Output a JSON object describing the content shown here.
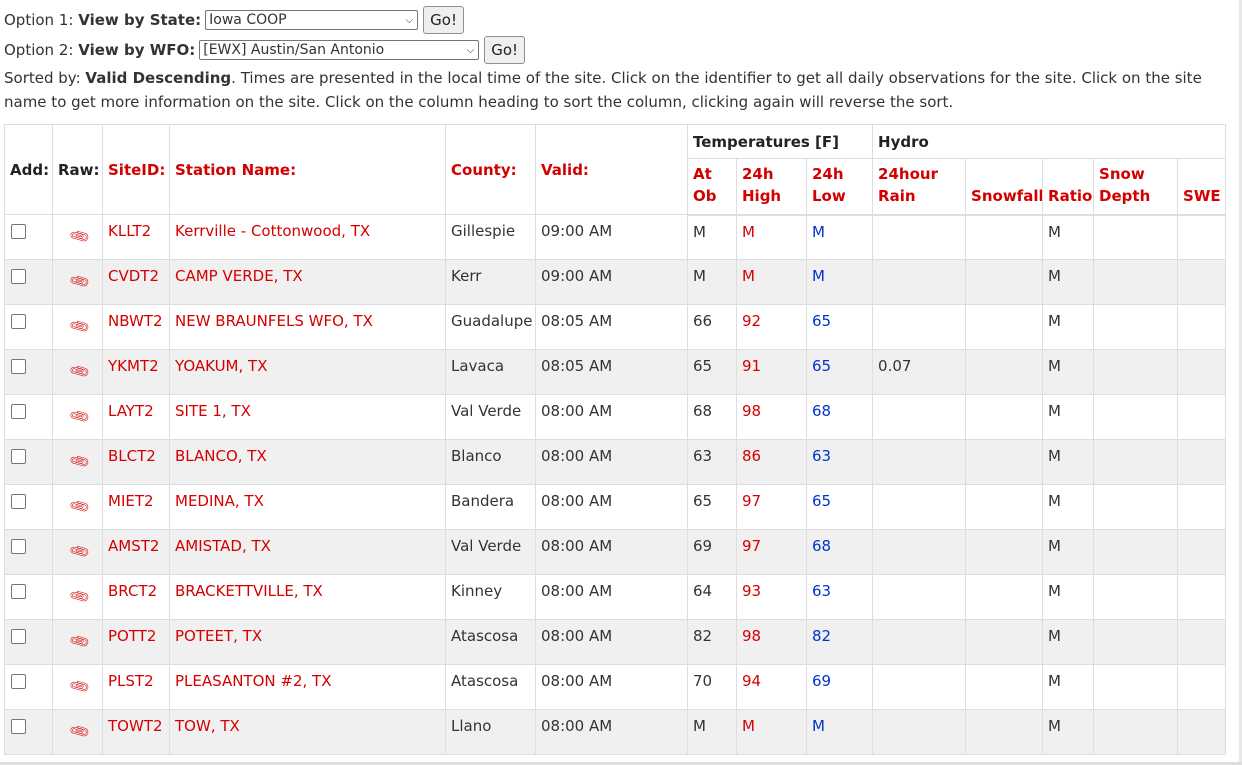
{
  "option1": {
    "prefix": "Option 1:",
    "label": "View by State:",
    "selected": "Iowa COOP",
    "go": "Go!"
  },
  "option2": {
    "prefix": "Option 2:",
    "label": "View by WFO:",
    "selected": "[EWX] Austin/San Antonio",
    "go": "Go!"
  },
  "info": {
    "sorted_prefix": "Sorted by:",
    "sorted_value": "Valid Descending",
    "text": ". Times are presented in the local time of the site. Click on the identifier to get all daily observations for the site. Click on the site name to get more information on the site. Click on the column heading to sort the column, clicking again will reverse the sort."
  },
  "table": {
    "group_temps": "Temperatures [F]",
    "group_hydro": "Hydro",
    "headers": {
      "add": "Add:",
      "raw": "Raw:",
      "siteid": "SiteID:",
      "name": "Station Name:",
      "county": "County:",
      "valid": "Valid:",
      "atob_1": "At",
      "atob_2": "Ob",
      "high_1": "24h",
      "high_2": "High",
      "low_1": "24h",
      "low_2": "Low",
      "rain_1": "24hour",
      "rain_2": "Rain",
      "snowfall": "Snowfall",
      "ratio": "Ratio",
      "depth_1": "Snow",
      "depth_2": "Depth",
      "swe": "SWE"
    },
    "rows": [
      {
        "id": "KLLT2",
        "name": "Kerrville - Cottonwood, TX",
        "county": "Gillespie",
        "valid": "09:00 AM",
        "atob": "M",
        "high": "M",
        "low": "M",
        "rain": "",
        "snowfall": "",
        "ratio": "M",
        "depth": "",
        "swe": ""
      },
      {
        "id": "CVDT2",
        "name": "CAMP VERDE, TX",
        "county": "Kerr",
        "valid": "09:00 AM",
        "atob": "M",
        "high": "M",
        "low": "M",
        "rain": "",
        "snowfall": "",
        "ratio": "M",
        "depth": "",
        "swe": ""
      },
      {
        "id": "NBWT2",
        "name": "NEW BRAUNFELS WFO, TX",
        "county": "Guadalupe",
        "valid": "08:05 AM",
        "atob": "66",
        "high": "92",
        "low": "65",
        "rain": "",
        "snowfall": "",
        "ratio": "M",
        "depth": "",
        "swe": ""
      },
      {
        "id": "YKMT2",
        "name": "YOAKUM, TX",
        "county": "Lavaca",
        "valid": "08:05 AM",
        "atob": "65",
        "high": "91",
        "low": "65",
        "rain": "0.07",
        "snowfall": "",
        "ratio": "M",
        "depth": "",
        "swe": ""
      },
      {
        "id": "LAYT2",
        "name": "SITE 1, TX",
        "county": "Val Verde",
        "valid": "08:00 AM",
        "atob": "68",
        "high": "98",
        "low": "68",
        "rain": "",
        "snowfall": "",
        "ratio": "M",
        "depth": "",
        "swe": ""
      },
      {
        "id": "BLCT2",
        "name": "BLANCO, TX",
        "county": "Blanco",
        "valid": "08:00 AM",
        "atob": "63",
        "high": "86",
        "low": "63",
        "rain": "",
        "snowfall": "",
        "ratio": "M",
        "depth": "",
        "swe": ""
      },
      {
        "id": "MIET2",
        "name": "MEDINA, TX",
        "county": "Bandera",
        "valid": "08:00 AM",
        "atob": "65",
        "high": "97",
        "low": "65",
        "rain": "",
        "snowfall": "",
        "ratio": "M",
        "depth": "",
        "swe": ""
      },
      {
        "id": "AMST2",
        "name": "AMISTAD, TX",
        "county": "Val Verde",
        "valid": "08:00 AM",
        "atob": "69",
        "high": "97",
        "low": "68",
        "rain": "",
        "snowfall": "",
        "ratio": "M",
        "depth": "",
        "swe": ""
      },
      {
        "id": "BRCT2",
        "name": "BRACKETTVILLE, TX",
        "county": "Kinney",
        "valid": "08:00 AM",
        "atob": "64",
        "high": "93",
        "low": "63",
        "rain": "",
        "snowfall": "",
        "ratio": "M",
        "depth": "",
        "swe": ""
      },
      {
        "id": "POTT2",
        "name": "POTEET, TX",
        "county": "Atascosa",
        "valid": "08:00 AM",
        "atob": "82",
        "high": "98",
        "low": "82",
        "rain": "",
        "snowfall": "",
        "ratio": "M",
        "depth": "",
        "swe": ""
      },
      {
        "id": "PLST2",
        "name": "PLEASANTON #2, TX",
        "county": "Atascosa",
        "valid": "08:00 AM",
        "atob": "70",
        "high": "94",
        "low": "69",
        "rain": "",
        "snowfall": "",
        "ratio": "M",
        "depth": "",
        "swe": ""
      },
      {
        "id": "TOWT2",
        "name": "TOW, TX",
        "county": "Llano",
        "valid": "08:00 AM",
        "atob": "M",
        "high": "M",
        "low": "M",
        "rain": "",
        "snowfall": "",
        "ratio": "M",
        "depth": "",
        "swe": ""
      }
    ]
  },
  "icons": {
    "raw": "paperclip-icon",
    "select_chevron": "chevron-down-icon"
  },
  "colors": {
    "link": "#d40000",
    "high": "#d40000",
    "low": "#0033cc",
    "stripe": "#f0f0f0",
    "border": "#dddddd"
  }
}
